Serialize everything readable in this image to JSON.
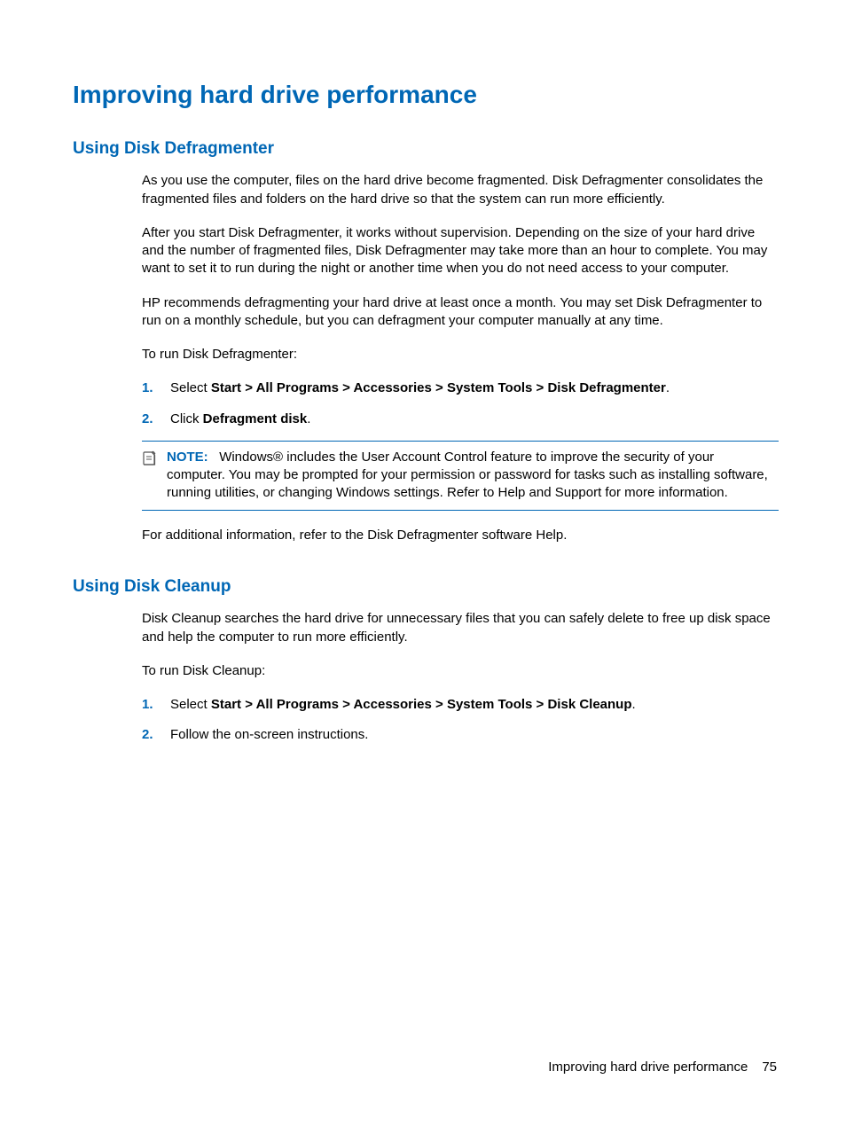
{
  "heading": {
    "title": "Improving hard drive performance"
  },
  "section1": {
    "title": "Using Disk Defragmenter",
    "p1": "As you use the computer, files on the hard drive become fragmented. Disk Defragmenter consolidates the fragmented files and folders on the hard drive so that the system can run more efficiently.",
    "p2": "After you start Disk Defragmenter, it works without supervision. Depending on the size of your hard drive and the number of fragmented files, Disk Defragmenter may take more than an hour to complete. You may want to set it to run during the night or another time when you do not need access to your computer.",
    "p3": "HP recommends defragmenting your hard drive at least once a month. You may set Disk Defragmenter to run on a monthly schedule, but you can defragment your computer manually at any time.",
    "p4": "To run Disk Defragmenter:",
    "steps": {
      "n1": "1.",
      "s1_pre": "Select ",
      "s1_bold": "Start > All Programs > Accessories > System Tools > Disk Defragmenter",
      "s1_post": ".",
      "n2": "2.",
      "s2_pre": "Click ",
      "s2_bold": "Defragment disk",
      "s2_post": "."
    },
    "note": {
      "label": "NOTE:",
      "text": "Windows® includes the User Account Control feature to improve the security of your computer. You may be prompted for your permission or password for tasks such as installing software, running utilities, or changing Windows settings. Refer to Help and Support for more information."
    },
    "p5": "For additional information, refer to the Disk Defragmenter software Help."
  },
  "section2": {
    "title": "Using Disk Cleanup",
    "p1": "Disk Cleanup searches the hard drive for unnecessary files that you can safely delete to free up disk space and help the computer to run more efficiently.",
    "p2": "To run Disk Cleanup:",
    "steps": {
      "n1": "1.",
      "s1_pre": "Select ",
      "s1_bold": "Start > All Programs > Accessories > System Tools > Disk Cleanup",
      "s1_post": ".",
      "n2": "2.",
      "s2_text": "Follow the on-screen instructions."
    }
  },
  "footer": {
    "title": "Improving hard drive performance",
    "page": "75"
  }
}
